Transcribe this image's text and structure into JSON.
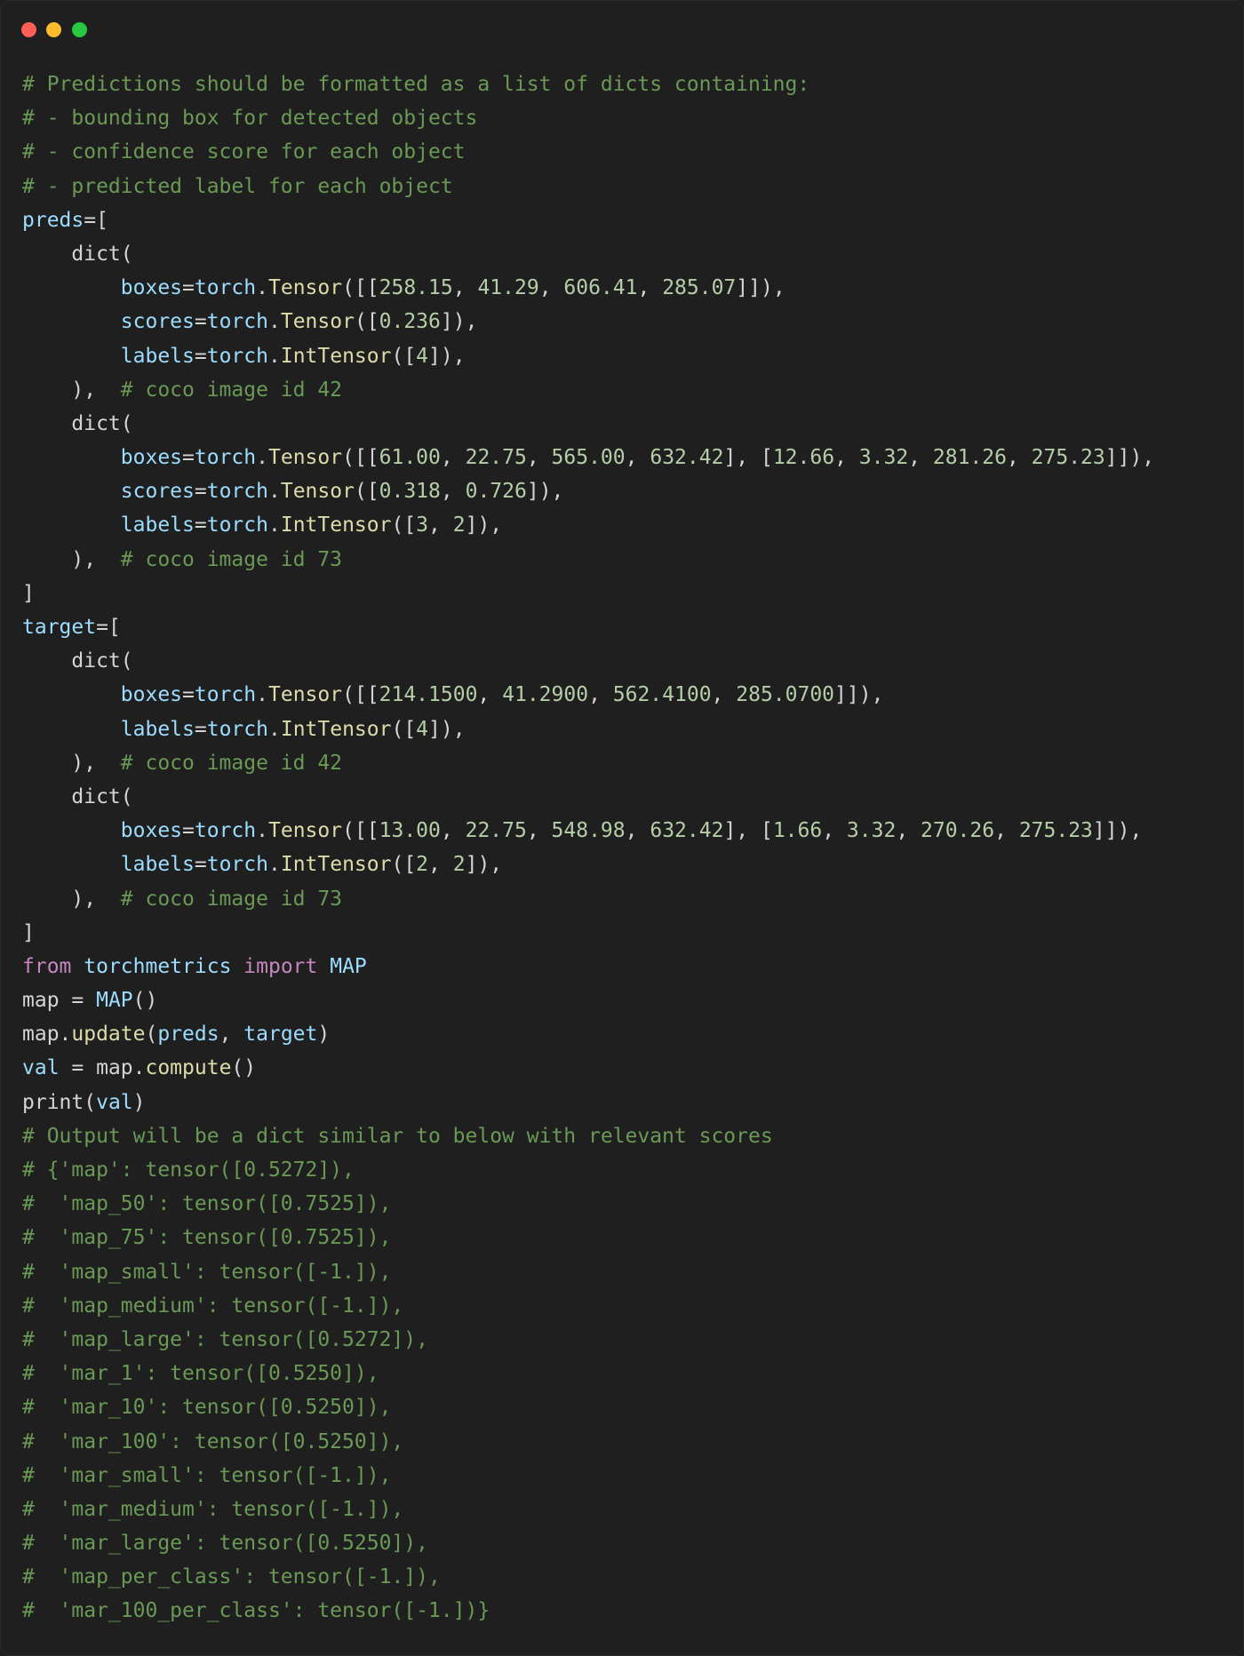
{
  "window": {
    "controls": [
      "close",
      "minimize",
      "maximize"
    ],
    "colors": {
      "close": "#ff5f57",
      "minimize": "#febc2e",
      "maximize": "#28c840",
      "background": "#1f1f1f"
    }
  },
  "code_lines": [
    [
      [
        "c",
        "# Predictions should be formatted as a list of dicts containing:"
      ]
    ],
    [
      [
        "c",
        "# - bounding box for detected objects"
      ]
    ],
    [
      [
        "c",
        "# - confidence score for each object"
      ]
    ],
    [
      [
        "c",
        "# - predicted label for each object"
      ]
    ],
    [
      [
        "v",
        "preds"
      ],
      [
        "p",
        "=["
      ]
    ],
    [
      [
        "p",
        "    dict("
      ]
    ],
    [
      [
        "p",
        "        "
      ],
      [
        "v",
        "boxes"
      ],
      [
        "p",
        "="
      ],
      [
        "v",
        "torch"
      ],
      [
        "p",
        "."
      ],
      [
        "f",
        "Tensor"
      ],
      [
        "p",
        "([["
      ],
      [
        "n",
        "258.15"
      ],
      [
        "p",
        ", "
      ],
      [
        "n",
        "41.29"
      ],
      [
        "p",
        ", "
      ],
      [
        "n",
        "606.41"
      ],
      [
        "p",
        ", "
      ],
      [
        "n",
        "285.07"
      ],
      [
        "p",
        "]]),"
      ]
    ],
    [
      [
        "p",
        "        "
      ],
      [
        "v",
        "scores"
      ],
      [
        "p",
        "="
      ],
      [
        "v",
        "torch"
      ],
      [
        "p",
        "."
      ],
      [
        "f",
        "Tensor"
      ],
      [
        "p",
        "(["
      ],
      [
        "n",
        "0.236"
      ],
      [
        "p",
        "]),"
      ]
    ],
    [
      [
        "p",
        "        "
      ],
      [
        "v",
        "labels"
      ],
      [
        "p",
        "="
      ],
      [
        "v",
        "torch"
      ],
      [
        "p",
        "."
      ],
      [
        "f",
        "IntTensor"
      ],
      [
        "p",
        "(["
      ],
      [
        "n",
        "4"
      ],
      [
        "p",
        "]),"
      ]
    ],
    [
      [
        "p",
        "    ),  "
      ],
      [
        "c",
        "# coco image id 42"
      ]
    ],
    [
      [
        "p",
        "    dict("
      ]
    ],
    [
      [
        "p",
        "        "
      ],
      [
        "v",
        "boxes"
      ],
      [
        "p",
        "="
      ],
      [
        "v",
        "torch"
      ],
      [
        "p",
        "."
      ],
      [
        "f",
        "Tensor"
      ],
      [
        "p",
        "([["
      ],
      [
        "n",
        "61.00"
      ],
      [
        "p",
        ", "
      ],
      [
        "n",
        "22.75"
      ],
      [
        "p",
        ", "
      ],
      [
        "n",
        "565.00"
      ],
      [
        "p",
        ", "
      ],
      [
        "n",
        "632.42"
      ],
      [
        "p",
        "], ["
      ],
      [
        "n",
        "12.66"
      ],
      [
        "p",
        ", "
      ],
      [
        "n",
        "3.32"
      ],
      [
        "p",
        ", "
      ],
      [
        "n",
        "281.26"
      ],
      [
        "p",
        ", "
      ],
      [
        "n",
        "275.23"
      ],
      [
        "p",
        "]]),"
      ]
    ],
    [
      [
        "p",
        "        "
      ],
      [
        "v",
        "scores"
      ],
      [
        "p",
        "="
      ],
      [
        "v",
        "torch"
      ],
      [
        "p",
        "."
      ],
      [
        "f",
        "Tensor"
      ],
      [
        "p",
        "(["
      ],
      [
        "n",
        "0.318"
      ],
      [
        "p",
        ", "
      ],
      [
        "n",
        "0.726"
      ],
      [
        "p",
        "]),"
      ]
    ],
    [
      [
        "p",
        "        "
      ],
      [
        "v",
        "labels"
      ],
      [
        "p",
        "="
      ],
      [
        "v",
        "torch"
      ],
      [
        "p",
        "."
      ],
      [
        "f",
        "IntTensor"
      ],
      [
        "p",
        "(["
      ],
      [
        "n",
        "3"
      ],
      [
        "p",
        ", "
      ],
      [
        "n",
        "2"
      ],
      [
        "p",
        "]),"
      ]
    ],
    [
      [
        "p",
        "    ),  "
      ],
      [
        "c",
        "# coco image id 73"
      ]
    ],
    [
      [
        "p",
        "]"
      ]
    ],
    [
      [
        "v",
        "target"
      ],
      [
        "p",
        "=["
      ]
    ],
    [
      [
        "p",
        "    dict("
      ]
    ],
    [
      [
        "p",
        "        "
      ],
      [
        "v",
        "boxes"
      ],
      [
        "p",
        "="
      ],
      [
        "v",
        "torch"
      ],
      [
        "p",
        "."
      ],
      [
        "f",
        "Tensor"
      ],
      [
        "p",
        "([["
      ],
      [
        "n",
        "214.1500"
      ],
      [
        "p",
        ", "
      ],
      [
        "n",
        "41.2900"
      ],
      [
        "p",
        ", "
      ],
      [
        "n",
        "562.4100"
      ],
      [
        "p",
        ", "
      ],
      [
        "n",
        "285.0700"
      ],
      [
        "p",
        "]]),"
      ]
    ],
    [
      [
        "p",
        "        "
      ],
      [
        "v",
        "labels"
      ],
      [
        "p",
        "="
      ],
      [
        "v",
        "torch"
      ],
      [
        "p",
        "."
      ],
      [
        "f",
        "IntTensor"
      ],
      [
        "p",
        "(["
      ],
      [
        "n",
        "4"
      ],
      [
        "p",
        "]),"
      ]
    ],
    [
      [
        "p",
        "    ),  "
      ],
      [
        "c",
        "# coco image id 42"
      ]
    ],
    [
      [
        "p",
        "    dict("
      ]
    ],
    [
      [
        "p",
        "        "
      ],
      [
        "v",
        "boxes"
      ],
      [
        "p",
        "="
      ],
      [
        "v",
        "torch"
      ],
      [
        "p",
        "."
      ],
      [
        "f",
        "Tensor"
      ],
      [
        "p",
        "([["
      ],
      [
        "n",
        "13.00"
      ],
      [
        "p",
        ", "
      ],
      [
        "n",
        "22.75"
      ],
      [
        "p",
        ", "
      ],
      [
        "n",
        "548.98"
      ],
      [
        "p",
        ", "
      ],
      [
        "n",
        "632.42"
      ],
      [
        "p",
        "], ["
      ],
      [
        "n",
        "1.66"
      ],
      [
        "p",
        ", "
      ],
      [
        "n",
        "3.32"
      ],
      [
        "p",
        ", "
      ],
      [
        "n",
        "270.26"
      ],
      [
        "p",
        ", "
      ],
      [
        "n",
        "275.23"
      ],
      [
        "p",
        "]]),"
      ]
    ],
    [
      [
        "p",
        "        "
      ],
      [
        "v",
        "labels"
      ],
      [
        "p",
        "="
      ],
      [
        "v",
        "torch"
      ],
      [
        "p",
        "."
      ],
      [
        "f",
        "IntTensor"
      ],
      [
        "p",
        "(["
      ],
      [
        "n",
        "2"
      ],
      [
        "p",
        ", "
      ],
      [
        "n",
        "2"
      ],
      [
        "p",
        "]),"
      ]
    ],
    [
      [
        "p",
        "    ),  "
      ],
      [
        "c",
        "# coco image id 73"
      ]
    ],
    [
      [
        "p",
        "]"
      ]
    ],
    [
      [
        "k",
        "from"
      ],
      [
        "p",
        " "
      ],
      [
        "v",
        "torchmetrics"
      ],
      [
        "p",
        " "
      ],
      [
        "k",
        "import"
      ],
      [
        "p",
        " "
      ],
      [
        "v",
        "MAP"
      ]
    ],
    [
      [
        "p",
        "map = "
      ],
      [
        "v",
        "MAP"
      ],
      [
        "p",
        "()"
      ]
    ],
    [
      [
        "p",
        "map."
      ],
      [
        "f",
        "update"
      ],
      [
        "p",
        "("
      ],
      [
        "v",
        "preds"
      ],
      [
        "p",
        ", "
      ],
      [
        "v",
        "target"
      ],
      [
        "p",
        ")"
      ]
    ],
    [
      [
        "v",
        "val"
      ],
      [
        "p",
        " = map."
      ],
      [
        "f",
        "compute"
      ],
      [
        "p",
        "()"
      ]
    ],
    [
      [
        "p",
        "print("
      ],
      [
        "v",
        "val"
      ],
      [
        "p",
        ")"
      ]
    ],
    [
      [
        "c",
        "# Output will be a dict similar to below with relevant scores"
      ]
    ],
    [
      [
        "c",
        "# {'map': tensor([0.5272]),"
      ]
    ],
    [
      [
        "c",
        "#  'map_50': tensor([0.7525]),"
      ]
    ],
    [
      [
        "c",
        "#  'map_75': tensor([0.7525]),"
      ]
    ],
    [
      [
        "c",
        "#  'map_small': tensor([-1.]),"
      ]
    ],
    [
      [
        "c",
        "#  'map_medium': tensor([-1.]),"
      ]
    ],
    [
      [
        "c",
        "#  'map_large': tensor([0.5272]),"
      ]
    ],
    [
      [
        "c",
        "#  'mar_1': tensor([0.5250]),"
      ]
    ],
    [
      [
        "c",
        "#  'mar_10': tensor([0.5250]),"
      ]
    ],
    [
      [
        "c",
        "#  'mar_100': tensor([0.5250]),"
      ]
    ],
    [
      [
        "c",
        "#  'mar_small': tensor([-1.]),"
      ]
    ],
    [
      [
        "c",
        "#  'mar_medium': tensor([-1.]),"
      ]
    ],
    [
      [
        "c",
        "#  'mar_large': tensor([0.5250]),"
      ]
    ],
    [
      [
        "c",
        "#  'map_per_class': tensor([-1.]),"
      ]
    ],
    [
      [
        "c",
        "#  'mar_100_per_class': tensor([-1.])}"
      ]
    ]
  ]
}
